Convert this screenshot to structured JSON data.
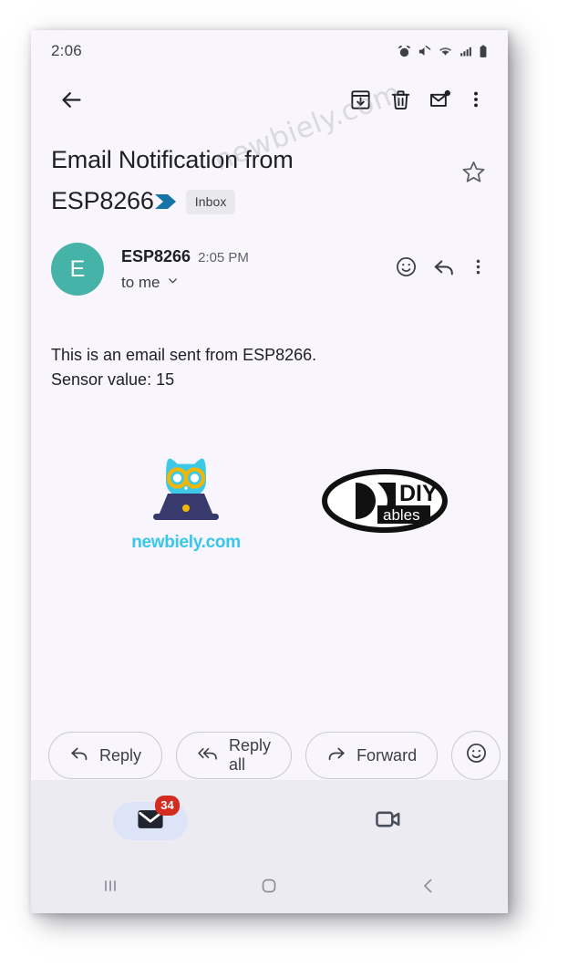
{
  "watermark": {
    "text": "newbiely.com"
  },
  "status_bar": {
    "time": "2:06",
    "icons": [
      "alarm-icon",
      "mute-icon",
      "wifi-icon",
      "signal-icon",
      "battery-icon"
    ]
  },
  "toolbar": {
    "back_icon": "back-arrow-icon",
    "archive_icon": "archive-icon",
    "delete_icon": "trash-icon",
    "unread_icon": "mark-unread-icon",
    "overflow_icon": "more-vertical-icon"
  },
  "email": {
    "subject_line1": "Email Notification from",
    "subject_line2": "ESP8266",
    "label_chip": "Inbox",
    "star_icon": "star-outline-icon",
    "sender": {
      "avatar_letter": "E",
      "avatar_color": "#45b3a7",
      "name": "ESP8266",
      "time": "2:05 PM",
      "recipient": "to me"
    },
    "sender_actions": {
      "emoji_icon": "smiley-icon",
      "reply_icon": "reply-arrow-icon",
      "overflow_icon": "more-vertical-icon"
    },
    "body": [
      "This is an email sent from ESP8266.",
      "Sensor value: 15"
    ],
    "signature_logos": [
      {
        "name": "newbiely-logo",
        "wordmark": "newbiely.com",
        "brand_color": "#38c6ea",
        "accent_color": "#f2b705",
        "laptop_color": "#383a6e"
      },
      {
        "name": "diyables-logo",
        "text_top": "DIY",
        "text_bottom": "ables"
      }
    ]
  },
  "reply_actions": [
    {
      "label": "Reply",
      "icon": "reply-arrow-icon"
    },
    {
      "label": "Reply all",
      "icon": "reply-all-arrow-icon"
    },
    {
      "label": "Forward",
      "icon": "forward-arrow-icon"
    }
  ],
  "emoji_action": {
    "icon": "smiley-icon"
  },
  "bottom_nav": {
    "mail": {
      "icon": "mail-icon",
      "badge": "34",
      "badge_color": "#d42b20",
      "selected": true
    },
    "meet": {
      "icon": "video-camera-icon",
      "selected": false
    }
  },
  "system_nav": {
    "recents_icon": "recents-icon",
    "home_icon": "home-icon",
    "back_icon": "back-chevron-icon"
  }
}
